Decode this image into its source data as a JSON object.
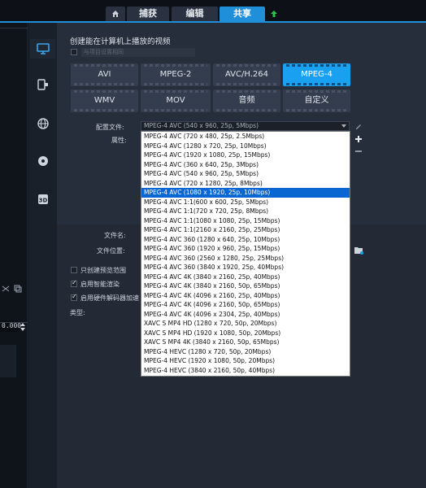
{
  "topbar": {
    "home_icon": "home-icon",
    "tabs": [
      {
        "label": "捕获"
      },
      {
        "label": "编辑"
      },
      {
        "label": "共享"
      }
    ],
    "upload_icon": "upload-arrow-icon",
    "active_color": "#1e8fd8"
  },
  "sidebar": {
    "icons": [
      "monitor-icon",
      "device-icon",
      "globe-icon",
      "disc-icon",
      "3d-icon"
    ]
  },
  "timecode": "0.000",
  "share": {
    "heading": "创建能在计算机上播放的视频",
    "match_project": "与项目设置相同",
    "formats": [
      {
        "label": "AVI"
      },
      {
        "label": "MPEG-2"
      },
      {
        "label": "AVC/H.264"
      },
      {
        "label": "MPEG-4"
      },
      {
        "label": "WMV"
      },
      {
        "label": "MOV"
      },
      {
        "label": "音频"
      },
      {
        "label": "自定义"
      }
    ],
    "selected_format": "MPEG-4",
    "profile_label": "配置文件:",
    "properties_label": "属性:",
    "profile_value": "MPEG-4 AVC (540 x 960, 25p, 5Mbps)",
    "profile_options": [
      "MPEG-4 AVC (720 x 480, 25p, 2.5Mbps)",
      "MPEG-4 AVC (1280 x 720, 25p, 10Mbps)",
      "MPEG-4 AVC (1920 x 1080, 25p, 15Mbps)",
      "MPEG-4 AVC (360 x 640, 25p, 3Mbps)",
      "MPEG-4 AVC (540 x 960, 25p, 5Mbps)",
      "MPEG-4 AVC (720 x 1280, 25p, 8Mbps)",
      "MPEG-4 AVC (1080 x 1920, 25p, 10Mbps)",
      "MPEG-4 AVC 1:1(600 x 600, 25p, 5Mbps)",
      "MPEG-4 AVC 1:1(720 x 720, 25p, 8Mbps)",
      "MPEG-4 AVC 1:1(1080 x 1080, 25p, 15Mbps)",
      "MPEG-4 AVC 1:1(2160 x 2160, 25p, 25Mbps)",
      "MPEG-4 AVC 360 (1280 x 640, 25p, 10Mbps)",
      "MPEG-4 AVC 360 (1920 x 960, 25p, 15Mbps)",
      "MPEG-4 AVC 360 (2560 x 1280, 25p, 25Mbps)",
      "MPEG-4 AVC 360 (3840 x 1920, 25p, 40Mbps)",
      "MPEG-4 AVC 4K (3840 x 2160, 25p, 40Mbps)",
      "MPEG-4 AVC 4K (3840 x 2160, 50p, 65Mbps)",
      "MPEG-4 AVC 4K (4096 x 2160, 25p, 40Mbps)",
      "MPEG-4 AVC 4K (4096 x 2160, 50p, 65Mbps)",
      "MPEG-4 AVC 4K (4096 x 2304, 25p, 40Mbps)",
      "XAVC S MP4 HD (1280 x 720, 50p, 20Mbps)",
      "XAVC S MP4 HD (1920 x 1080, 50p, 20Mbps)",
      "XAVC S MP4 4K (3840 x 2160, 50p, 65Mbps)",
      "MPEG-4 HEVC (1280 x 720, 50p, 20Mbps)",
      "MPEG-4 HEVC (1920 x 1080, 50p, 20Mbps)",
      "MPEG-4 HEVC (3840 x 2160, 50p, 40Mbps)"
    ],
    "selected_option": "MPEG-4 AVC (1080 x 1920, 25p, 10Mbps)",
    "filename_label": "文件名:",
    "location_label": "文件位置:",
    "preview_only": "只创建预览范围",
    "smart_render": "启用智能渲染",
    "hw_accel": "启用硬件解码器加速",
    "type_label": "类型:",
    "accent": "#1aa0f0"
  }
}
